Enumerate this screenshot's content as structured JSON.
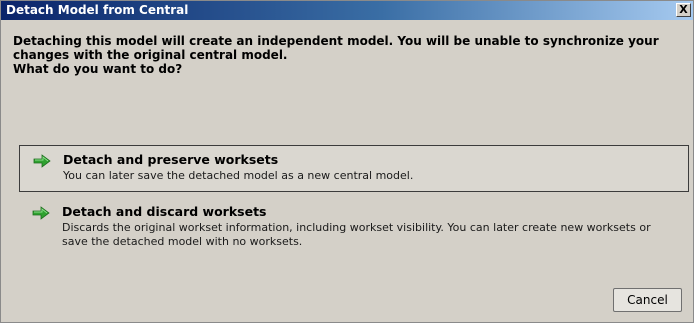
{
  "window": {
    "title": "Detach Model from Central",
    "close_label": "X"
  },
  "message": {
    "line1": "Detaching this model will create an independent model. You will be unable to synchronize your changes with the original central model.",
    "line2": "What do you want to do?"
  },
  "options": [
    {
      "title": "Detach and preserve worksets",
      "description": "You can later save the detached model as a new central model.",
      "icon": "green-arrow-icon",
      "selected": true
    },
    {
      "title": "Detach and discard worksets",
      "description": "Discards the original workset information, including workset visibility. You can later create new worksets or save the detached model with no worksets.",
      "icon": "green-arrow-icon",
      "selected": false
    }
  ],
  "buttons": {
    "cancel_label": "Cancel"
  },
  "colors": {
    "titlebar_start": "#0a246a",
    "titlebar_end": "#a6caf0",
    "arrow": "#2fa12f",
    "dialog_bg": "#d4d0c8"
  }
}
